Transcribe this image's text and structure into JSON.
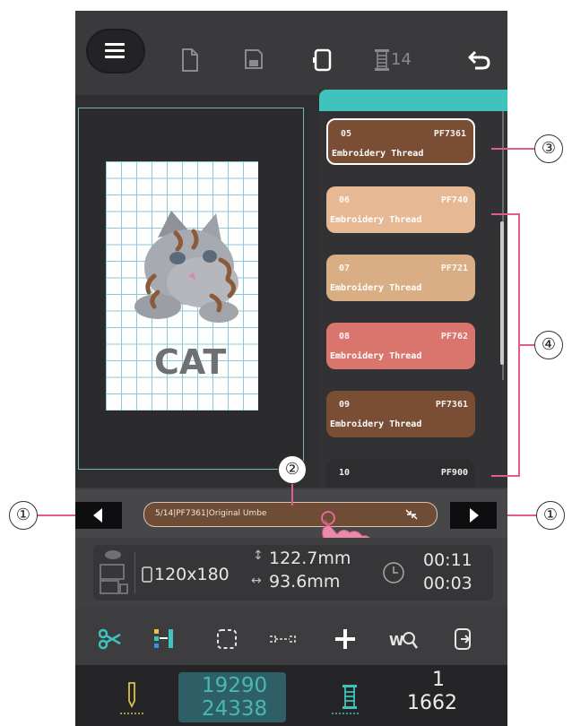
{
  "toolbar": {
    "thread_count": "14"
  },
  "preview": {
    "design_text": "CAT"
  },
  "threads": [
    {
      "num": "05",
      "code": "PF7361",
      "name": "Embroidery Thread",
      "color": "#7a4e35",
      "selected": true
    },
    {
      "num": "06",
      "code": "PF740",
      "name": "Embroidery Thread",
      "color": "#e6b894"
    },
    {
      "num": "07",
      "code": "PF721",
      "name": "Embroidery Thread",
      "color": "#d9ae84"
    },
    {
      "num": "08",
      "code": "PF762",
      "name": "Embroidery Thread",
      "color": "#d9756d"
    },
    {
      "num": "09",
      "code": "PF7361",
      "name": "Embroidery Thread",
      "color": "#7a4e35"
    },
    {
      "num": "10",
      "code": "PF900",
      "name": "",
      "color": "#2d2d2f"
    }
  ],
  "status": {
    "text": "5/14|PF7361|Original Umbe"
  },
  "info": {
    "size": "120x180",
    "height": "122.7mm",
    "width": "93.6mm",
    "time_total": "00:11",
    "time_left": "00:03"
  },
  "bottom": {
    "stitch_current": "19290",
    "stitch_total": "24338",
    "color_current": "1",
    "color_total": "1662"
  },
  "callouts": [
    "①",
    "②",
    "③",
    "④",
    "①"
  ],
  "colors": {
    "accent": "#3ec3bd",
    "callout_line": "#e05b8f",
    "panel": "#3d3d3f"
  }
}
